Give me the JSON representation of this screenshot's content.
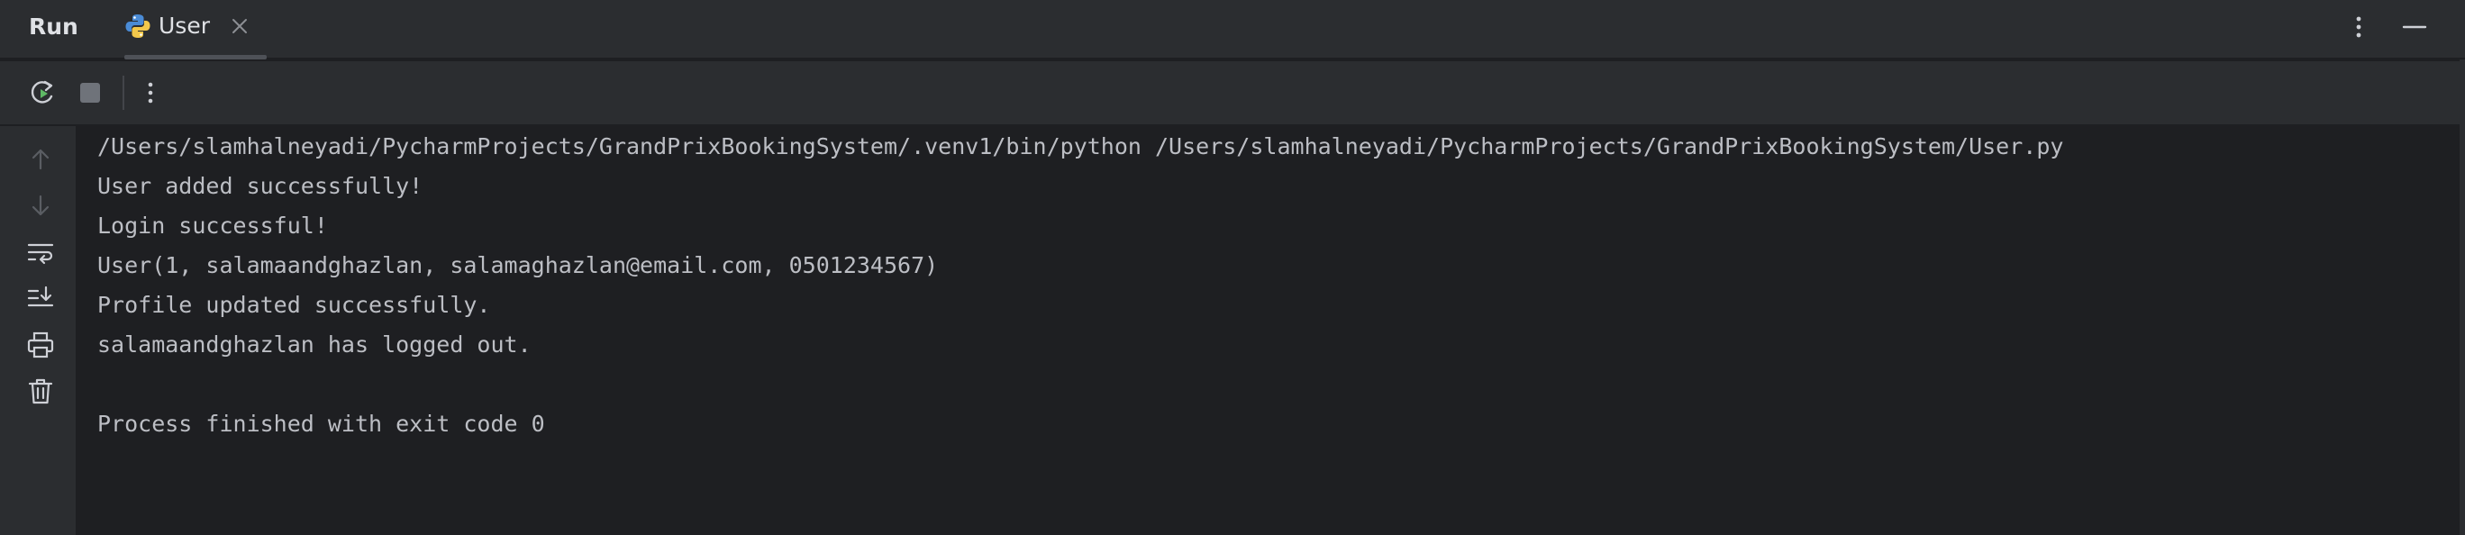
{
  "header": {
    "title": "Run",
    "tab": {
      "label": "User",
      "icon": "python-icon"
    }
  },
  "toolbar": {
    "buttons": [
      "rerun-icon",
      "stop-icon",
      "more-vertical-icon"
    ]
  },
  "gutter": {
    "buttons": [
      "arrow-up-icon",
      "arrow-down-icon",
      "soft-wrap-icon",
      "scroll-to-end-icon",
      "print-icon",
      "trash-icon"
    ]
  },
  "console": {
    "lines": [
      "/Users/slamhalneyadi/PycharmProjects/GrandPrixBookingSystem/.venv1/bin/python /Users/slamhalneyadi/PycharmProjects/GrandPrixBookingSystem/User.py",
      "User added successfully!",
      "Login successful!",
      "User(1, salamaandghazlan, salamaghazlan@email.com, 0501234567)",
      "Profile updated successfully.",
      "salamaandghazlan has logged out.",
      "",
      "Process finished with exit code 0"
    ]
  },
  "colors": {
    "background": "#1e1f22",
    "panel": "#2b2d30",
    "text": "#bcbec4",
    "rerun_green": "#5fb865",
    "icon_gray": "#6f737a"
  }
}
